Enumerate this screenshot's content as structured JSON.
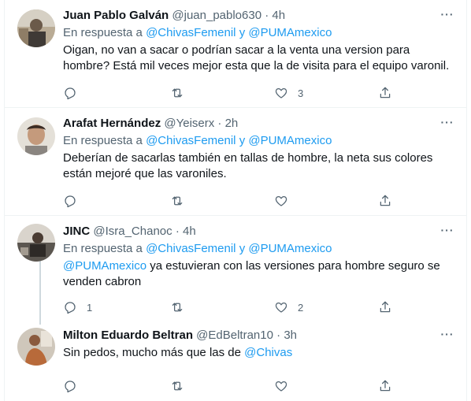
{
  "reply_prefix": "En respuesta a",
  "reply_conj": "y",
  "tweets": [
    {
      "name": "Juan Pablo Galván",
      "handle": "@juan_pablo630",
      "time": "4h",
      "reply_to": [
        "@ChivasFemenil",
        "@PUMAmexico"
      ],
      "text": "Oigan, no van a sacar o podrían sacar a la venta una version para hombre? Está mil veces mejor esta que la de visita para el equipo varonil.",
      "replies": "",
      "retweets": "",
      "likes": "3"
    },
    {
      "name": "Arafat Hernández",
      "handle": "@Yeiserx",
      "time": "2h",
      "reply_to": [
        "@ChivasFemenil",
        "@PUMAmexico"
      ],
      "text": "Deberían de sacarlas también en tallas de hombre, la neta sus colores están mejoré que las varoniles.",
      "replies": "",
      "retweets": "",
      "likes": ""
    },
    {
      "name": "JINC",
      "handle": "@Isra_Chanoc",
      "time": "4h",
      "reply_to": [
        "@ChivasFemenil",
        "@PUMAmexico"
      ],
      "mention": "@PUMAmexico",
      "text": " ya estuvieran con las versiones para hombre seguro se venden cabron",
      "replies": "1",
      "retweets": "",
      "likes": "2"
    },
    {
      "name": "Milton Eduardo Beltran",
      "handle": "@EdBeltran10",
      "time": "3h",
      "text": "Sin pedos, mucho más que las de ",
      "mention": "@Chivas",
      "replies": "",
      "retweets": "",
      "likes": ""
    }
  ]
}
